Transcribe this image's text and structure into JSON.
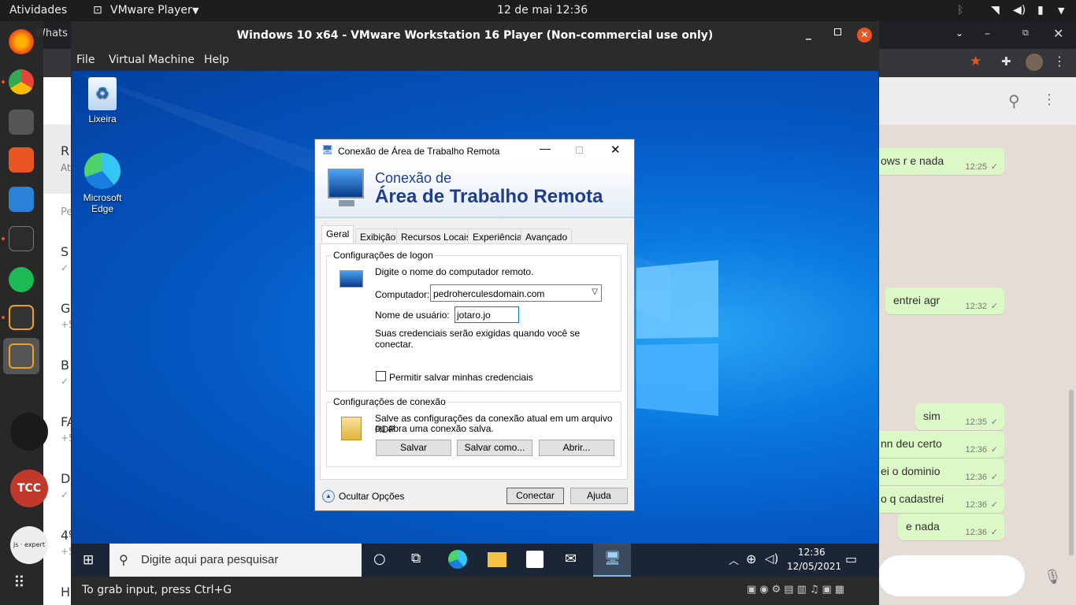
{
  "topbar": {
    "activities": "Atividades",
    "app_menu": "VMware Player",
    "clock": "12 de mai  12:36"
  },
  "chrome": {
    "tab_fragment": "Whats"
  },
  "whatsapp": {
    "left_fragments": [
      {
        "letter": "R",
        "sub": "At"
      },
      {
        "letter": "Pe",
        "sub": ""
      },
      {
        "letter": "S",
        "sub": "✓"
      },
      {
        "letter": "G",
        "sub": "+5"
      },
      {
        "letter": "B",
        "sub": "✓"
      },
      {
        "letter": "FA",
        "sub": "+5"
      },
      {
        "letter": "D",
        "sub": "✓"
      },
      {
        "letter": "4º",
        "sub": "+5"
      },
      {
        "letter": "H",
        "sub": ""
      }
    ],
    "messages": [
      {
        "text": "ows r e nada",
        "time": "12:25"
      },
      {
        "text": "entrei agr",
        "time": "12:32"
      },
      {
        "text": "sim",
        "time": "12:35"
      },
      {
        "text": "nn deu certo",
        "time": "12:36"
      },
      {
        "text": "ei o dominio",
        "time": "12:36"
      },
      {
        "text": "o q cadastrei",
        "time": "12:36"
      },
      {
        "text": "e nada",
        "time": "12:36"
      }
    ],
    "dock_avatar_texts": [
      "js · expert"
    ]
  },
  "vmware": {
    "title": "Windows 10 x64 - VMware Workstation 16 Player (Non-commercial use only)",
    "menu": [
      "File",
      "Virtual Machine",
      "Help"
    ],
    "status_hint": "To grab input, press Ctrl+G"
  },
  "desktop": {
    "icons": [
      "Lixeira",
      "Microsoft Edge"
    ]
  },
  "taskbar": {
    "search_placeholder": "Digite aqui para pesquisar",
    "time": "12:36",
    "date": "12/05/2021"
  },
  "rdp": {
    "title": "Conexão de Área de Trabalho Remota",
    "banner_line1": "Conexão de",
    "banner_line2": "Área de Trabalho Remota",
    "tabs": [
      "Geral",
      "Exibição",
      "Recursos Locais",
      "Experiência",
      "Avançado"
    ],
    "logon_group": "Configurações de logon",
    "logon_hint": "Digite o nome do computador remoto.",
    "computer_label": "Computador:",
    "computer_value": "pedroherculesdomain.com",
    "user_label": "Nome de usuário:",
    "user_value": "jotaro.jo",
    "cred_note": "Suas credenciais serão exigidas quando você se conectar.",
    "save_cred_label": "Permitir salvar minhas credenciais",
    "conn_group": "Configurações de conexão",
    "conn_hint_1": "Salve as configurações da conexão atual em um arquivo RDP",
    "conn_hint_2": "ou abra uma conexão salva.",
    "btn_save": "Salvar",
    "btn_save_as": "Salvar como...",
    "btn_open": "Abrir...",
    "hide_options": "Ocultar Opções",
    "btn_connect": "Conectar",
    "btn_help": "Ajuda"
  },
  "colors": {
    "accent_ubuntu": "#e95420",
    "vmware_close": "#e95420",
    "rdp_banner_text": "#1e3e8c"
  }
}
